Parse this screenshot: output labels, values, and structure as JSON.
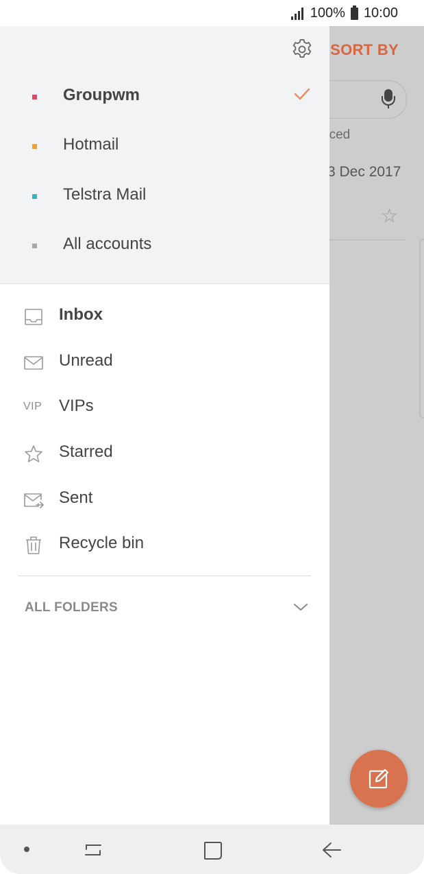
{
  "status_bar": {
    "battery": "100%",
    "time": "10:00"
  },
  "background_app": {
    "sort_by": "SORT BY",
    "advanced_fragment": "nced",
    "date_fragment": "3 Dec 2017"
  },
  "drawer": {
    "accounts": [
      {
        "label": "Groupwm",
        "color": "#e0446a",
        "selected": true
      },
      {
        "label": "Hotmail",
        "color": "#f0a030",
        "selected": false
      },
      {
        "label": "Telstra Mail",
        "color": "#33b5c3",
        "selected": false
      },
      {
        "label": "All accounts",
        "color": "#a8a8a8",
        "selected": false
      }
    ],
    "folders": [
      {
        "label": "Inbox",
        "icon": "inbox-icon",
        "active": true
      },
      {
        "label": "Unread",
        "icon": "envelope-icon",
        "active": false
      },
      {
        "label": "VIPs",
        "icon": "vip-icon",
        "icon_text": "VIP",
        "active": false
      },
      {
        "label": "Starred",
        "icon": "star-icon",
        "active": false
      },
      {
        "label": "Sent",
        "icon": "sent-icon",
        "active": false
      },
      {
        "label": "Recycle bin",
        "icon": "trash-icon",
        "active": false
      }
    ],
    "all_folders_label": "ALL FOLDERS"
  },
  "colors": {
    "accent": "#d9663f",
    "fab": "#d9734f",
    "check": "#f08a5d",
    "drawer_header_bg": "#f2f3f5",
    "scrim": "#cdcdcd"
  }
}
